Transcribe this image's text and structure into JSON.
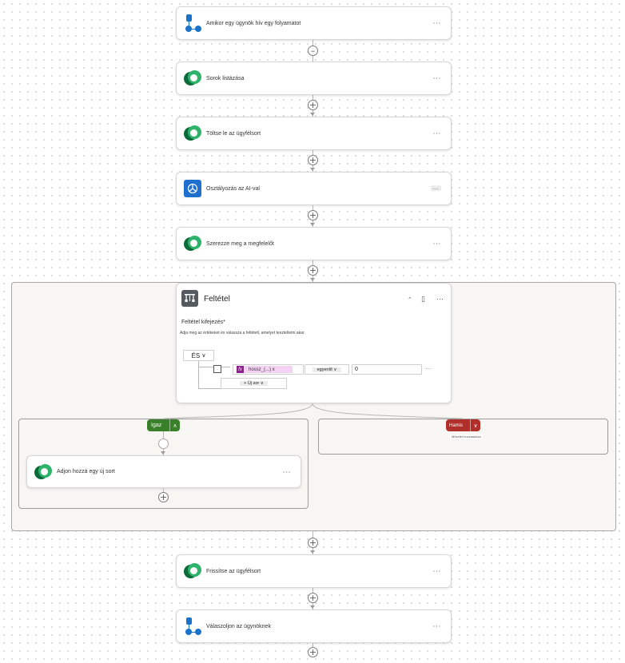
{
  "steps": {
    "trigger": {
      "title": "Amikor egy ügynök hív egy folyamatot"
    },
    "step1": {
      "title": "Sorok listázása"
    },
    "step2": {
      "title": "Töltse le az ügyfélsort"
    },
    "step3": {
      "title": "Osztályozás az AI-val"
    },
    "step4": {
      "title": "Szerezze meg a megfelelőt"
    },
    "step6": {
      "title": "Frissítse az ügyfélsort"
    },
    "step7": {
      "title": "Válaszoljon az ügynöknek"
    }
  },
  "more_label": "···",
  "step3_more_label": "...",
  "condition": {
    "title": "Feltétel",
    "section_label": "Feltétel kifejezés*",
    "description": "Adja meg az értékeket és válassza a feltételt, amelyet teszteltetni akar.",
    "group_label": "ÉS",
    "group_chevron": "∨",
    "function_token": "fx",
    "function_name": "hossz_(...)",
    "function_close": "x",
    "operator": "egyenlő",
    "operator_chevron": "∨",
    "value": "0",
    "add_label": "+ Új sor",
    "add_chevron": "∨",
    "row_more": "···"
  },
  "branch_true": {
    "label": "Igaz",
    "chevron": "∧",
    "step_title": "Adjon hozzá egy új sort"
  },
  "branch_false": {
    "label": "Hamis",
    "chevron": "∨",
    "sub_label": "Művelet hozzáadása"
  },
  "icons": {
    "dataverse": "dataverse-icon",
    "flow": "flow-trigger-icon",
    "ai": "ai-builder-icon",
    "condition": "condition-icon",
    "plus": "plus-icon",
    "collapse": "collapse-icon"
  },
  "colors": {
    "true_branch": "#3a7f2a",
    "false_branch": "#b12f2a",
    "ai_icon": "#1f6fcf",
    "dataverse_dark": "#0b6a3a",
    "dataverse_light": "#2fb36a",
    "flow_icon": "#1a73c9",
    "expression_token": "#8a1f8c"
  }
}
